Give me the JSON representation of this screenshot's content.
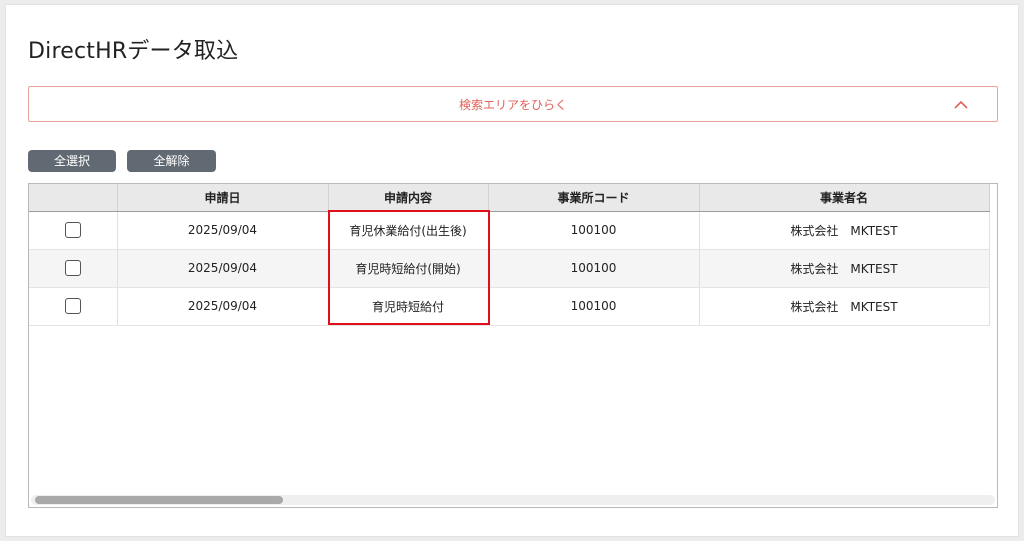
{
  "page": {
    "title": "DirectHRデータ取込"
  },
  "search": {
    "toggle_label": "検索エリアをひらく",
    "chevron_icon": "chevron-up-icon"
  },
  "toolbar": {
    "select_all_label": "全選択",
    "deselect_all_label": "全解除"
  },
  "table": {
    "headers": [
      "",
      "申請日",
      "申請内容",
      "事業所コード",
      "事業者名"
    ],
    "rows": [
      {
        "checked": false,
        "date": "2025/09/04",
        "content": "育児休業給付(出生後)",
        "office_code": "100100",
        "company": "株式会社　MKTEST"
      },
      {
        "checked": false,
        "date": "2025/09/04",
        "content": "育児時短給付(開始)",
        "office_code": "100100",
        "company": "株式会社　MKTEST"
      },
      {
        "checked": false,
        "date": "2025/09/04",
        "content": "育児時短給付",
        "office_code": "100100",
        "company": "株式会社　MKTEST"
      }
    ]
  },
  "colors": {
    "accent": "#e0625a",
    "button": "#616a73",
    "highlight": "#e0101a"
  }
}
